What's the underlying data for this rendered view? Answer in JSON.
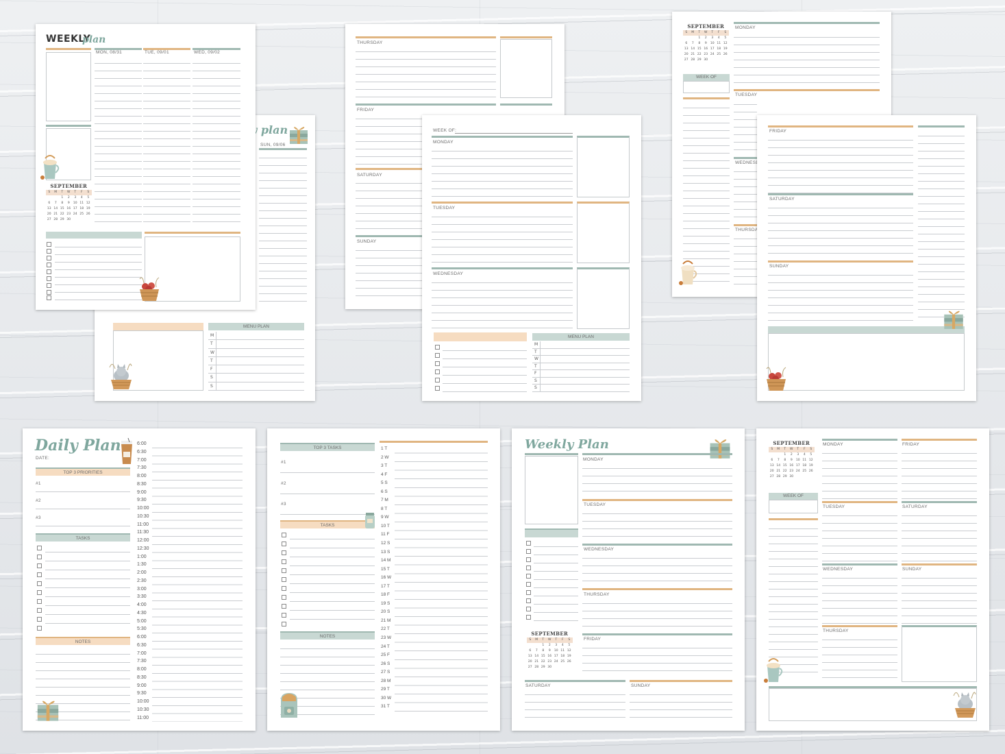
{
  "p1": {
    "title_bold": "WEEKLY",
    "title_script": "plan",
    "days": [
      "MON, 08/31",
      "TUE, 09/01",
      "WED, 09/02"
    ],
    "cal_month": "SEPTEMBER"
  },
  "p2": {
    "title": "y plan",
    "day": "SUN, 09/06",
    "menu": "MENU PLAN",
    "menu_days": [
      "M",
      "T",
      "W",
      "T",
      "F",
      "S",
      "S"
    ]
  },
  "p3": {
    "days": [
      "THURSDAY",
      "FRIDAY",
      "SATURDAY",
      "SUNDAY"
    ]
  },
  "p4": {
    "week_of": "WEEK OF:",
    "days": [
      "MONDAY",
      "TUESDAY",
      "WEDNESDAY"
    ],
    "menu": "MENU PLAN",
    "menu_days": [
      "M",
      "T",
      "W",
      "T",
      "F",
      "S",
      "S"
    ]
  },
  "p5": {
    "cal_month": "SEPTEMBER",
    "week_of": "WEEK OF",
    "days": [
      "MONDAY",
      "TUESDAY",
      "WEDNESD",
      "THURSDA"
    ]
  },
  "p6": {
    "days": [
      "FRIDAY",
      "SATURDAY",
      "SUNDAY"
    ]
  },
  "p7": {
    "title": "Daily Plan",
    "date": "DATE:",
    "priorities": "TOP 3 PRIORITIES",
    "p1": "#1",
    "p2": "#2",
    "p3": "#3",
    "tasks": "TASKS",
    "notes": "NOTES",
    "times": [
      "6:00",
      "6:30",
      "7:00",
      "7:30",
      "8:00",
      "8:30",
      "9:00",
      "9:30",
      "10:00",
      "10:30",
      "11:00",
      "11:30",
      "12:00",
      "12:30",
      "1:00",
      "1:30",
      "2:00",
      "2:30",
      "3:00",
      "3:30",
      "4:00",
      "4:30",
      "5:00",
      "5:30",
      "6:00",
      "6:30",
      "7:00",
      "7:30",
      "8:00",
      "8:30",
      "9:00",
      "9:30",
      "10:00",
      "10:30",
      "11:00"
    ]
  },
  "p8": {
    "tasks_title": "TOP 3 TASKS",
    "t1": "#1",
    "t2": "#2",
    "t3": "#3",
    "tasks": "TASKS",
    "notes": "NOTES",
    "dates": [
      "1 T",
      "2 W",
      "3 T",
      "4 F",
      "5 S",
      "6 S",
      "7 M",
      "8 T",
      "9 W",
      "10 T",
      "11 F",
      "12 S",
      "13 S",
      "14 M",
      "15 T",
      "16 W",
      "17 T",
      "18 F",
      "19 S",
      "20 S",
      "21 M",
      "22 T",
      "23 W",
      "24 T",
      "25 F",
      "26 S",
      "27 S",
      "28 M",
      "29 T",
      "30 W",
      "31 T"
    ]
  },
  "p9": {
    "title": "Weekly Plan",
    "days": [
      "MONDAY",
      "TUESDAY",
      "WEDNESDAY",
      "THURSDAY",
      "FRIDAY",
      "SATURDAY",
      "SUNDAY"
    ],
    "cal_month": "SEPTEMBER"
  },
  "p10": {
    "cal_month": "SEPTEMBER",
    "week_of": "WEEK OF",
    "days": [
      "MONDAY",
      "FRIDAY",
      "TUESDAY",
      "SATURDAY",
      "WEDNESDAY",
      "SUNDAY",
      "THURSDAY"
    ]
  },
  "calendar": {
    "weekdays": [
      "S",
      "M",
      "T",
      "W",
      "T",
      "F",
      "S"
    ],
    "rows": [
      [
        "",
        "",
        "1",
        "2",
        "3",
        "4",
        "5"
      ],
      [
        "6",
        "7",
        "8",
        "9",
        "10",
        "11",
        "12"
      ],
      [
        "13",
        "14",
        "15",
        "16",
        "17",
        "18",
        "19"
      ],
      [
        "20",
        "21",
        "22",
        "23",
        "24",
        "25",
        "26"
      ],
      [
        "27",
        "28",
        "29",
        "30",
        "",
        "",
        ""
      ]
    ]
  }
}
